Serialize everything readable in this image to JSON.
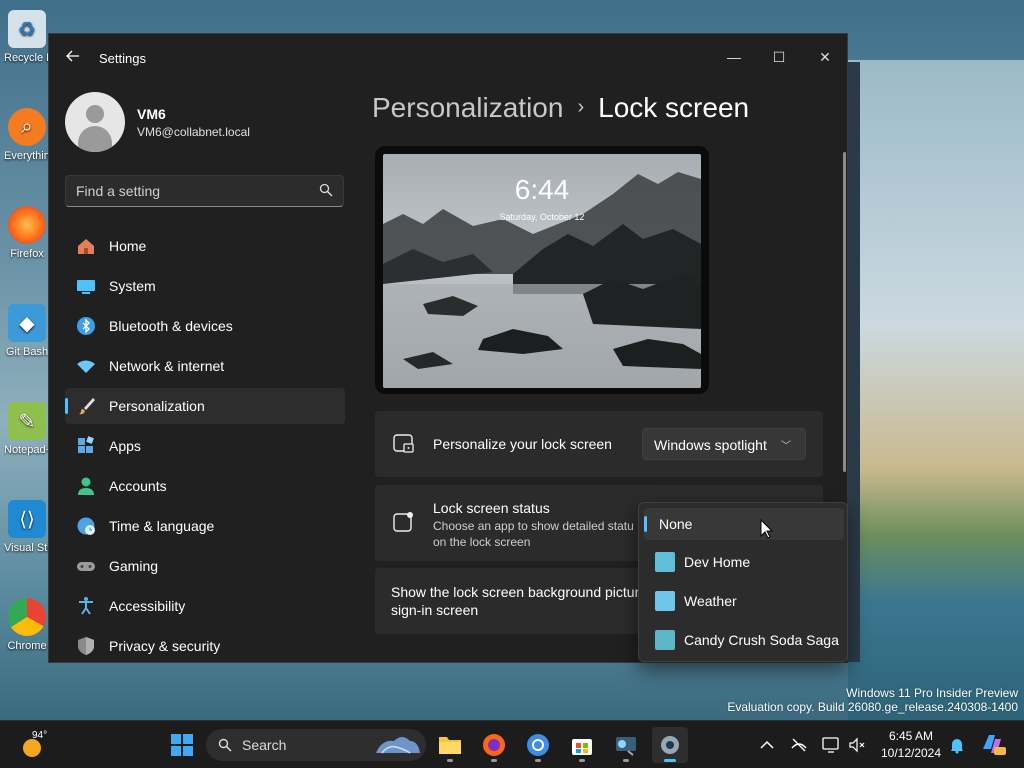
{
  "desktop": {
    "icons": [
      {
        "label": "Recycle Bin",
        "color": "#cfd8e0"
      },
      {
        "label": "Everything",
        "color": "#f47b20"
      },
      {
        "label": "Firefox",
        "color": "#ff6611"
      },
      {
        "label": "Git Bash",
        "color": "#3c9ad8"
      },
      {
        "label": "Notepad++",
        "color": "#8fc04e"
      },
      {
        "label": "Visual Studio Code",
        "color": "#1f8ad2"
      },
      {
        "label": "Chrome",
        "color": "#3c8ee8"
      }
    ],
    "watermark_line1": "Windows 11 Pro Insider Preview",
    "watermark_line2": "Evaluation copy. Build 26080.ge_release.240308-1400"
  },
  "window": {
    "title": "Settings",
    "back_icon": "back-arrow-icon",
    "controls": {
      "minimize": "—",
      "maximize": "☐",
      "close": "✕"
    }
  },
  "user": {
    "name": "VM6",
    "email": "VM6@collabnet.local"
  },
  "search": {
    "placeholder": "Find a setting"
  },
  "nav": [
    {
      "label": "Home",
      "icon": "home-icon",
      "color": "#e67e5c"
    },
    {
      "label": "System",
      "icon": "system-icon",
      "color": "#4cc2ff"
    },
    {
      "label": "Bluetooth & devices",
      "icon": "bluetooth-icon",
      "color": "#3a9fe8"
    },
    {
      "label": "Network & internet",
      "icon": "wifi-icon",
      "color": "#6ec6ff"
    },
    {
      "label": "Personalization",
      "icon": "brush-icon",
      "color": "#e8a15c",
      "active": true
    },
    {
      "label": "Apps",
      "icon": "apps-icon",
      "color": "#5fa9e8"
    },
    {
      "label": "Accounts",
      "icon": "accounts-icon",
      "color": "#3ec48c"
    },
    {
      "label": "Time & language",
      "icon": "clock-globe-icon",
      "color": "#4aa3e8"
    },
    {
      "label": "Gaming",
      "icon": "gamepad-icon",
      "color": "#9a9a9a"
    },
    {
      "label": "Accessibility",
      "icon": "accessibility-icon",
      "color": "#5ab4f0"
    },
    {
      "label": "Privacy & security",
      "icon": "shield-icon",
      "color": "#8a8a8a"
    }
  ],
  "breadcrumb": {
    "parent": "Personalization",
    "separator": "›",
    "current": "Lock screen"
  },
  "preview": {
    "time": "6:44",
    "date": "Saturday, October 12"
  },
  "settings": {
    "personalize": {
      "title": "Personalize your lock screen",
      "value": "Windows spotlight"
    },
    "status": {
      "title": "Lock screen status",
      "desc_line1": "Choose an app to show detailed statu",
      "desc_line2": "on the lock screen"
    },
    "background": {
      "line1": "Show the lock screen background pictur",
      "line2": "sign-in screen"
    }
  },
  "status_menu": {
    "items": [
      {
        "label": "None",
        "selected": true,
        "color": ""
      },
      {
        "label": "Dev Home",
        "selected": false,
        "color": "#5fbfd6"
      },
      {
        "label": "Weather",
        "selected": false,
        "color": "#6ec6e8"
      },
      {
        "label": "Candy Crush Soda Saga",
        "selected": false,
        "color": "#5ab8c8"
      }
    ]
  },
  "taskbar": {
    "weather_temp": "94°",
    "search_label": "Search",
    "clock_time": "6:45 AM",
    "clock_date": "10/12/2024",
    "apps": [
      "windows-start-icon",
      "file-explorer-icon",
      "firefox-icon",
      "chrome-icon",
      "store-icon",
      "terminal-icon",
      "settings-icon"
    ],
    "tray": [
      "chevron-up-icon",
      "network-icon",
      "display-icon",
      "volume-muted-icon",
      "notification-bell-icon",
      "copilot-icon"
    ]
  }
}
